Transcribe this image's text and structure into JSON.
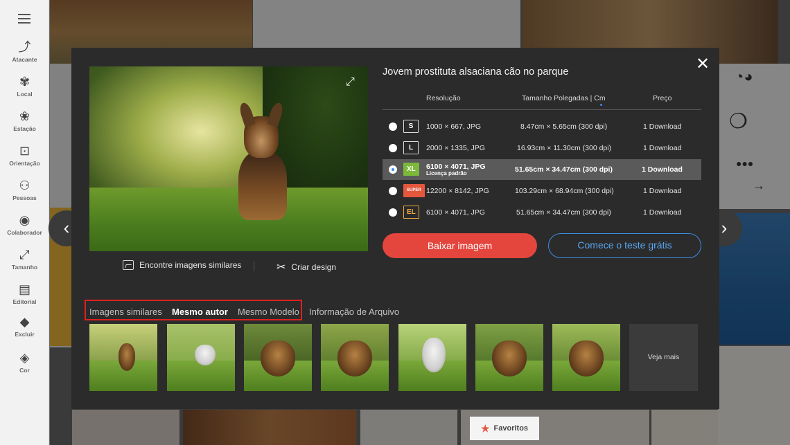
{
  "sidebar": {
    "items": [
      {
        "icon": "trending-icon",
        "glyph": "⤴",
        "label": "Atacante"
      },
      {
        "icon": "local-icon",
        "glyph": "✾",
        "label": "Local"
      },
      {
        "icon": "season-icon",
        "glyph": "❀",
        "label": "Estação"
      },
      {
        "icon": "orientation-icon",
        "glyph": "⊡",
        "label": "Orientação"
      },
      {
        "icon": "people-icon",
        "glyph": "⚇",
        "label": "Pessoas"
      },
      {
        "icon": "contributor-icon",
        "glyph": "◉",
        "label": "Colaborador"
      },
      {
        "icon": "size-icon",
        "glyph": "⤢",
        "label": "Tamanho"
      },
      {
        "icon": "editorial-icon",
        "glyph": "▤",
        "label": "Editorial"
      },
      {
        "icon": "exclude-icon",
        "glyph": "◆",
        "label": "Excluir"
      },
      {
        "icon": "color-icon",
        "glyph": "◈",
        "label": "Cor"
      }
    ]
  },
  "background": {
    "favorites_label": "Favoritos"
  },
  "modal": {
    "title": "Jovem prostituta alsaciana cão no parque",
    "headers": {
      "resolution": "Resolução",
      "size": "Tamanho Polegadas | Cm",
      "price": "Preço"
    },
    "rows": [
      {
        "badge": "S",
        "resolution": "1000 × 667, JPG",
        "license": "",
        "size": "8.47cm × 5.65cm (300 dpi)",
        "price": "1 Download",
        "selected": false
      },
      {
        "badge": "L",
        "resolution": "2000 × 1335, JPG",
        "license": "",
        "size": "16.93cm × 11.30cm (300 dpi)",
        "price": "1 Download",
        "selected": false
      },
      {
        "badge": "XL",
        "resolution": "6100 × 4071, JPG",
        "license": "Licença padrão",
        "size": "51.65cm × 34.47cm (300 dpi)",
        "price": "1 Download",
        "selected": true
      },
      {
        "badge": "SUPER",
        "resolution": "12200 × 8142, JPG",
        "license": "",
        "size": "103.29cm × 68.94cm (300 dpi)",
        "price": "1 Download",
        "selected": false
      },
      {
        "badge": "EL",
        "resolution": "6100 × 4071, JPG",
        "license": "",
        "size": "51.65cm × 34.47cm (300 dpi)",
        "price": "1 Download",
        "selected": false
      }
    ],
    "download_button": "Baixar imagem",
    "trial_button": "Comece o teste grátis",
    "find_similar": "Encontre imagens similares",
    "create_design": "Criar design",
    "tabs": [
      "Imagens similares",
      "Mesmo autor",
      "Mesmo Modelo",
      "Informação de Arquivo"
    ],
    "active_tab": "Mesmo autor",
    "see_more": "Veja mais",
    "accent_colors": {
      "download": "#e4463d",
      "trial": "#3a8ee6",
      "xl": "#7cb83a",
      "super": "#e4573d",
      "el": "#f1a940",
      "highlight": "#e02020"
    }
  }
}
